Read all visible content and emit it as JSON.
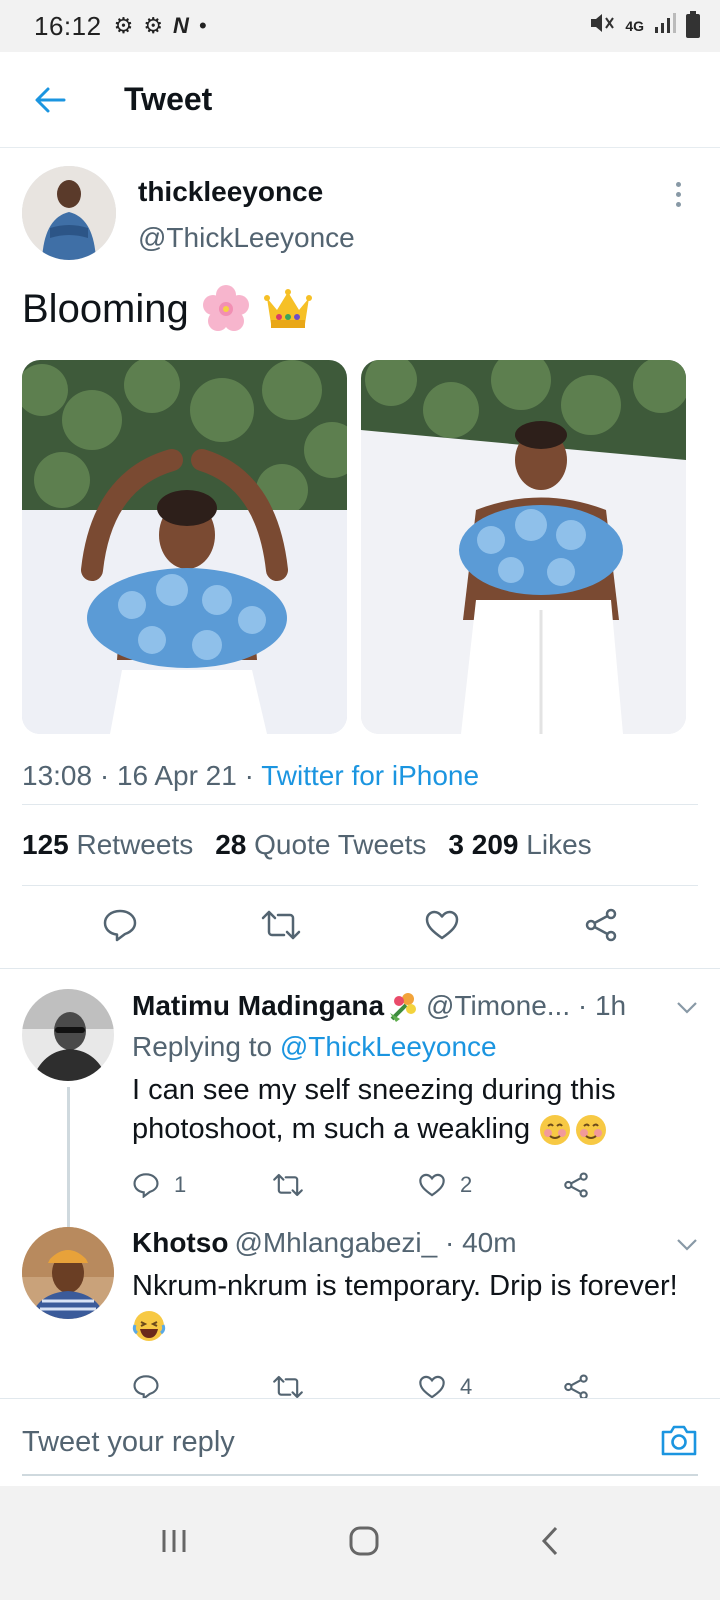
{
  "status_bar": {
    "time": "16:12",
    "network": "4G"
  },
  "header": {
    "title": "Tweet"
  },
  "tweet": {
    "author_name": "thickleeyonce",
    "author_handle": "@ThickLeeyonce",
    "text": "Blooming",
    "emojis": [
      "cherry-blossom",
      "crown"
    ],
    "timestamp": "13:08 · 16 Apr 21 · ",
    "source": "Twitter for iPhone",
    "stats": {
      "retweets_count": "125",
      "retweets_label": "Retweets",
      "quotes_count": "28",
      "quotes_label": "Quote Tweets",
      "likes_count": "3 209",
      "likes_label": "Likes"
    }
  },
  "replies": [
    {
      "name": "Matimu Madingana",
      "handle": "@Timone... · 1h",
      "replying_prefix": "Replying to ",
      "replying_to": "@ThickLeeyonce",
      "text": "I can see my self sneezing during this photoshoot, m such a weakling",
      "reply_count": "1",
      "like_count": "2"
    },
    {
      "name": "Khotso",
      "handle": "@Mhlangabezi_ · 40m",
      "text": "Nkrum-nkrum is temporary. Drip is forever!",
      "like_count": "4"
    }
  ],
  "composer": {
    "placeholder": "Tweet your reply"
  },
  "colors": {
    "accent": "#1b95e0",
    "secondary_text": "#536471"
  }
}
